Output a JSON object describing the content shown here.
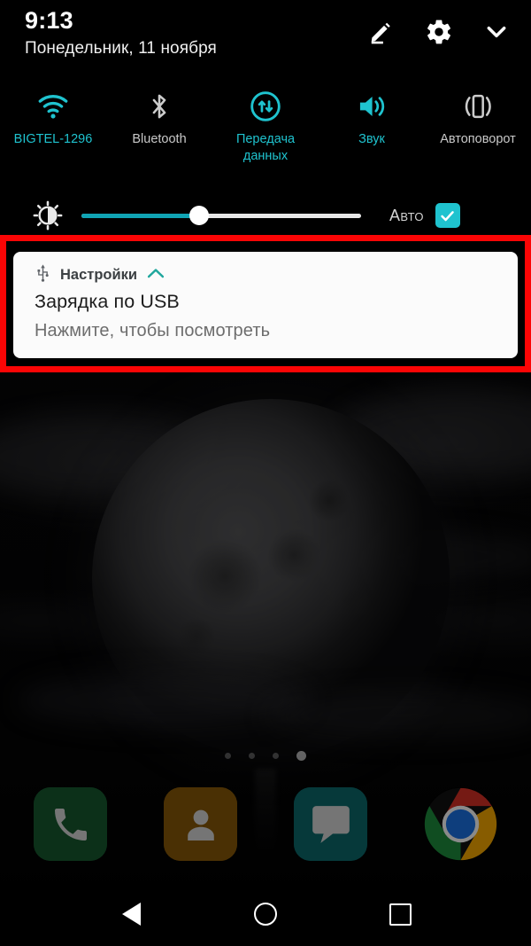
{
  "status_bar": {
    "time": "9:13",
    "date": "Понедельник, 11 ноября",
    "icons": [
      {
        "name": "edit-icon",
        "label": "Редактировать"
      },
      {
        "name": "gear-icon",
        "label": "Настройки"
      },
      {
        "name": "chevron-down-icon",
        "label": "Свернуть"
      }
    ]
  },
  "quick_settings": {
    "tiles": [
      {
        "icon": "wifi-icon",
        "label": "BIGTEL-1296",
        "state": "on"
      },
      {
        "icon": "bluetooth-icon",
        "label": "Bluetooth",
        "state": "off"
      },
      {
        "icon": "mobile-data-icon",
        "label": "Передача данных",
        "state": "on"
      },
      {
        "icon": "volume-icon",
        "label": "Звук",
        "state": "on"
      },
      {
        "icon": "auto-rotate-icon",
        "label": "Автоповорот",
        "state": "off"
      }
    ],
    "active_color": "#1fc3cf",
    "inactive_color": "#c9c9c9"
  },
  "brightness": {
    "icon": "brightness-icon",
    "value_percent": 42,
    "auto_label": "Авто",
    "auto_checked": true,
    "fill_color": "#10a4b4",
    "track_color": "#e8e8e8",
    "checkbox_color": "#1fc3cf"
  },
  "notification": {
    "app_icon": "usb-icon",
    "app_name": "Настройки",
    "expand_icon": "chevron-up-icon",
    "expand_color": "#20a79d",
    "title": "Зарядка по USB",
    "subtitle": "Нажмите, чтобы посмотреть",
    "highlight_color": "#fb0505",
    "card_background": "#fbfbfb"
  },
  "home_screen": {
    "wallpaper_description": "Тёмная луна в облаках",
    "page_dots": {
      "count": 4,
      "active_index": 3
    },
    "dock": [
      {
        "icon": "phone-icon",
        "label": "Телефон",
        "color": "#17592f"
      },
      {
        "icon": "contacts-icon",
        "label": "Контакты",
        "color": "#8a5a08"
      },
      {
        "icon": "messages-icon",
        "label": "Сообщения",
        "color": "#0c6a6c"
      },
      {
        "icon": "chrome-icon",
        "label": "Chrome",
        "color": "#4285f4"
      }
    ]
  },
  "navigation_bar": {
    "buttons": [
      {
        "icon": "back-icon",
        "label": "Назад"
      },
      {
        "icon": "home-icon",
        "label": "Главный экран"
      },
      {
        "icon": "recents-icon",
        "label": "Недавние приложения"
      }
    ]
  }
}
